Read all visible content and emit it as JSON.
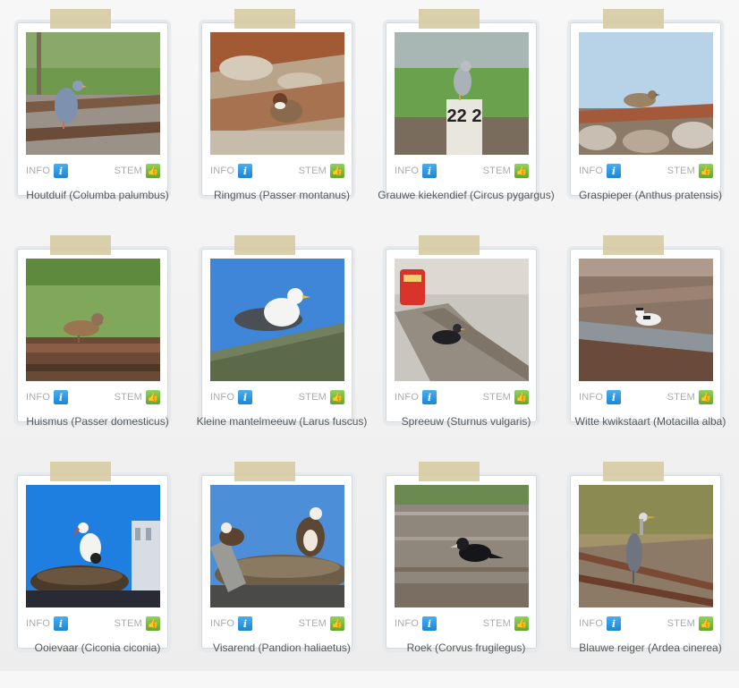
{
  "actions": {
    "info_label": "INFO",
    "stem_label": "STEM",
    "info_icon": "info-icon",
    "stem_icon": "thumbs-up-icon"
  },
  "colors": {
    "info": "#1a86d6",
    "stem": "#5ea82d",
    "tape": "#d6caa0",
    "caption": "#55595c"
  },
  "birds": [
    {
      "name": "Houtduif (Columba palumbus)"
    },
    {
      "name": "Ringmus (Passer montanus)"
    },
    {
      "name": "Grauwe kiekendief (Circus pygargus)",
      "marker_text": "22 2"
    },
    {
      "name": "Graspieper (Anthus pratensis)"
    },
    {
      "name": "Huismus (Passer domesticus)"
    },
    {
      "name": "Kleine mantelmeeuw (Larus fuscus)"
    },
    {
      "name": "Spreeuw (Sturnus vulgaris)"
    },
    {
      "name": "Witte kwikstaart (Motacilla alba)"
    },
    {
      "name": "Ooievaar (Ciconia ciconia)"
    },
    {
      "name": "Visarend (Pandion haliaetus)"
    },
    {
      "name": "Roek (Corvus frugilegus)"
    },
    {
      "name": "Blauwe reiger (Ardea cinerea)"
    }
  ]
}
